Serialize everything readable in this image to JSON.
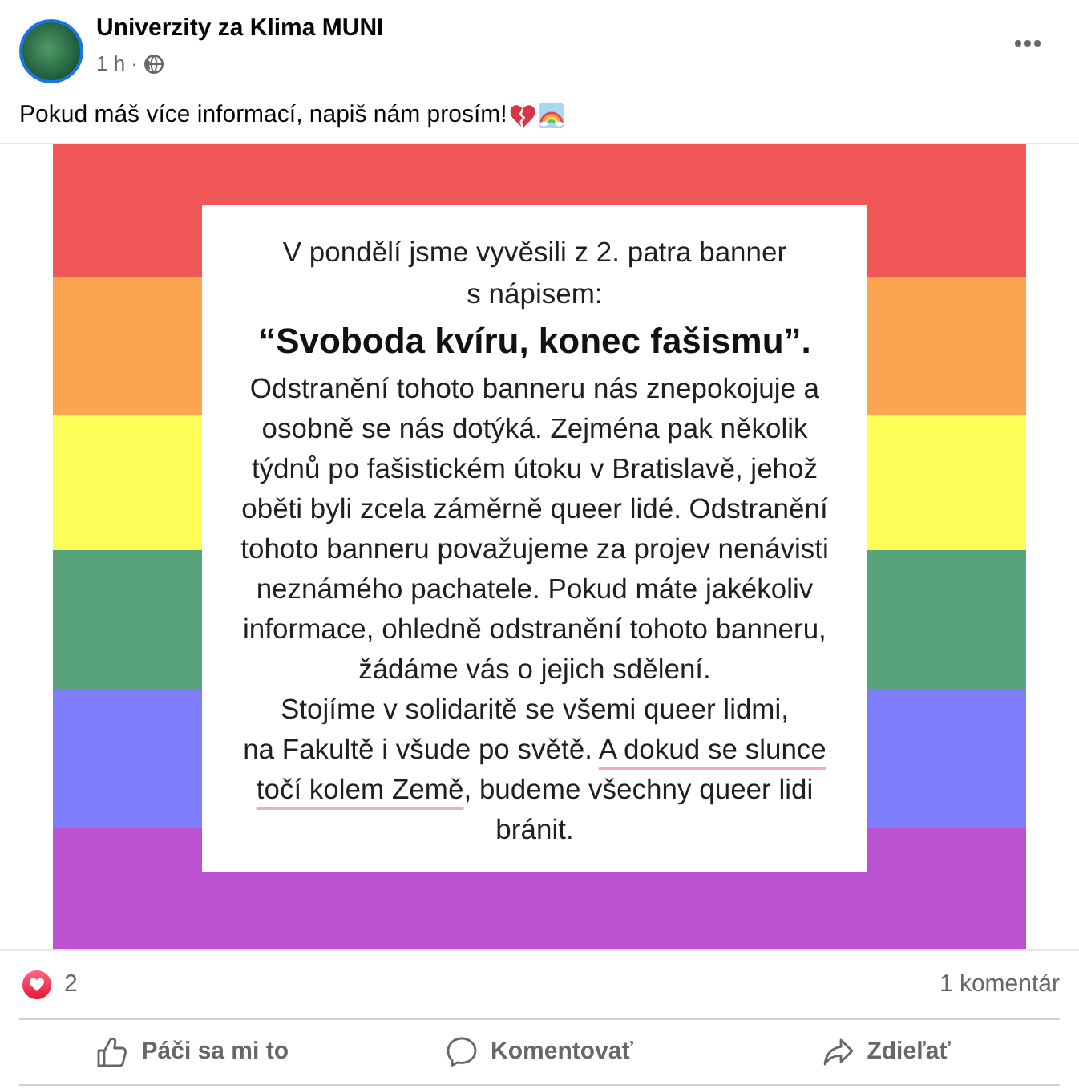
{
  "post": {
    "author": "Univerzity za Klima MUNI",
    "time": "1 h ·",
    "text": "Pokud máš více informací, napiš nám prosím!"
  },
  "poster": {
    "paragraphs": [
      {
        "kind": "plain",
        "segments": [
          {
            "text": "V pondělí jsme vyvěsili z 2. patra banner\ns nápisem:",
            "underlined": false
          }
        ]
      },
      {
        "kind": "headline",
        "segments": [
          {
            "text": "“Svoboda kvíru, konec fašismu”.",
            "underlined": false
          }
        ]
      },
      {
        "kind": "plain",
        "segments": [
          {
            "text": "Odstranění tohoto banneru nás znepokojuje a\nosobně se nás dotýká. Zejména pak několik\ntýdnů po fašistickém útoku v Bratislavě, jehož\noběti byli zcela záměrně queer lidé. Odstranění\ntohoto banneru považujeme za projev nenávisti\nneznámého pachatele. Pokud máte jakékoliv\ninformace, ohledně odstranění tohoto banneru,\nžádáme vás o jejich sdělení.",
            "underlined": false
          }
        ]
      },
      {
        "kind": "plain",
        "segments": [
          {
            "text": "Stojíme v solidaritě se všemi queer lidmi,\nna Fakultě i všude po světě. ",
            "underlined": false
          },
          {
            "text": "A dokud se slunce\ntočí kolem Země",
            "underlined": true
          },
          {
            "text": ", budeme všechny queer lidi\nbránit.",
            "underlined": false
          }
        ]
      }
    ]
  },
  "stats": {
    "reactions": "2",
    "comments": "1 komentár"
  },
  "actions": [
    {
      "kind": "like",
      "label": "Páči sa mi to"
    },
    {
      "kind": "comment",
      "label": "Komentovať"
    },
    {
      "kind": "share",
      "label": "Zdieľať"
    }
  ]
}
